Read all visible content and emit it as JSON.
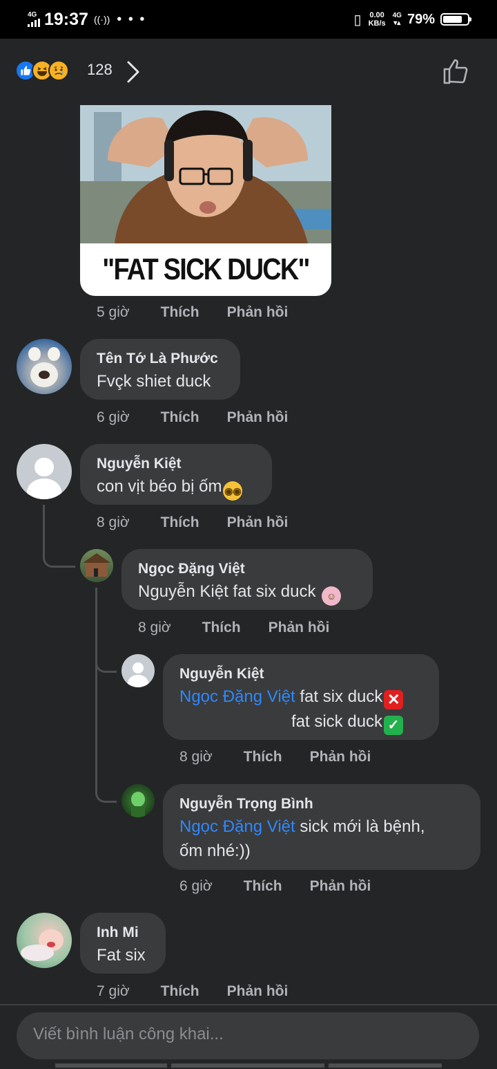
{
  "status_bar": {
    "network_left": "4G",
    "time": "19:37",
    "hotspot_icon": "hotspot-icon",
    "more": "• • •",
    "vibrate_icon": "vibrate-icon",
    "speed_value": "0.00",
    "speed_unit": "KB/s",
    "network_right": "4G",
    "battery_percent": "79%",
    "battery_level": 0.79
  },
  "reactions": {
    "icons": [
      "like-reaction-icon",
      "haha-reaction-icon",
      "sad-reaction-icon"
    ],
    "count": "128"
  },
  "meme": {
    "caption": "\"FAT SICK DUCK\""
  },
  "comments": [
    {
      "id": "c0",
      "time": "5 giờ",
      "like_label": "Thích",
      "reply_label": "Phản hồi"
    },
    {
      "id": "c1",
      "author": "Tên Tớ Là Phước",
      "text": "Fvçk shiet duck",
      "time": "6 giờ",
      "like_label": "Thích",
      "reply_label": "Phản hồi"
    },
    {
      "id": "c2",
      "author": "Nguyễn Kiệt",
      "text": "con vịt béo bị ốm",
      "time": "8 giờ",
      "like_label": "Thích",
      "reply_label": "Phản hồi",
      "replies": [
        {
          "id": "r1",
          "author": "Ngọc Đặng Việt",
          "text": "Nguyễn Kiệt fat six duck",
          "time": "8 giờ",
          "like_label": "Thích",
          "reply_label": "Phản hồi"
        },
        {
          "id": "r2",
          "author": "Nguyễn Kiệt",
          "mention": "Ngọc Đặng Việt",
          "text_line1": "fat six duck",
          "text_line2": "fat sick duck",
          "time": "8 giờ",
          "like_label": "Thích",
          "reply_label": "Phản hồi"
        },
        {
          "id": "r3",
          "author": "Nguyễn Trọng Bình",
          "mention": "Ngọc Đặng Việt",
          "text_line1": "sick mới là bệnh,",
          "text_line2": "ốm nhé:))",
          "time": "6 giờ",
          "like_label": "Thích",
          "reply_label": "Phản hồi"
        }
      ]
    },
    {
      "id": "c3",
      "author": "Inh Mi",
      "text": "Fat six",
      "time": "7 giờ",
      "like_label": "Thích",
      "reply_label": "Phản hồi"
    }
  ],
  "composer": {
    "placeholder": "Viết bình luận công khai..."
  },
  "colors": {
    "background": "#242526",
    "bubble": "#3a3b3c",
    "mention": "#2d88ff",
    "secondary_text": "#b0b3b8",
    "like_blue": "#1877f2"
  }
}
